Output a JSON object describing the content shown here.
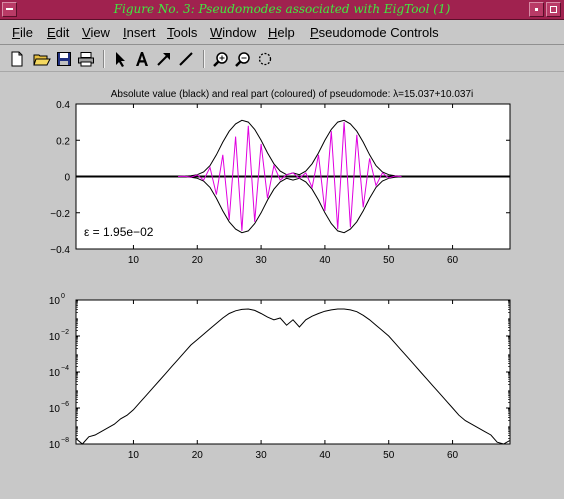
{
  "window": {
    "title": "Figure No. 3: Pseudomodes associated with EigTool (1)"
  },
  "menubar": {
    "items": [
      {
        "label": "File",
        "mnemonic": "F",
        "rest": "ile"
      },
      {
        "label": "Edit",
        "mnemonic": "E",
        "rest": "dit"
      },
      {
        "label": "View",
        "mnemonic": "V",
        "rest": "iew"
      },
      {
        "label": "Insert",
        "mnemonic": "I",
        "rest": "nsert"
      },
      {
        "label": "Tools",
        "mnemonic": "T",
        "rest": "ools"
      },
      {
        "label": "Window",
        "mnemonic": "W",
        "rest": "indow"
      },
      {
        "label": "Help",
        "mnemonic": "H",
        "rest": "elp"
      },
      {
        "label": "Pseudomode Controls",
        "mnemonic": "P",
        "rest": "seudomode Controls"
      }
    ]
  },
  "toolbar": {
    "icons": [
      "new-file-icon",
      "open-folder-icon",
      "save-icon",
      "print-icon",
      "arrow-pointer-icon",
      "text-insert-icon",
      "arrow-draw-icon",
      "line-draw-icon",
      "zoom-in-icon",
      "zoom-out-icon",
      "rotate-icon"
    ]
  },
  "colors": {
    "titlebar": "#a0224f",
    "title_text": "#40e840",
    "real_part": "#e000e0",
    "abs_value": "#000000"
  },
  "chart_data": [
    {
      "type": "line",
      "title": "Absolute value (black) and real part (coloured) of pseudomode: λ=15.037+10.037i",
      "annotation": "ε = 1.95e−02",
      "xlim": [
        1,
        69
      ],
      "ylim": [
        -0.4,
        0.4
      ],
      "xticks": [
        10,
        20,
        30,
        40,
        50,
        60
      ],
      "yticks": [
        -0.4,
        -0.2,
        0,
        0.2,
        0.4
      ],
      "ytick_labels": [
        "−0.4",
        "−0.2",
        "0",
        "0.2",
        "0.4"
      ],
      "grid": false,
      "series": [
        {
          "color": "#000000",
          "mirror": true,
          "x": [
            1,
            2,
            3,
            4,
            5,
            6,
            7,
            8,
            9,
            10,
            11,
            12,
            13,
            14,
            15,
            16,
            17,
            18,
            19,
            20,
            21,
            22,
            23,
            24,
            25,
            26,
            27,
            28,
            29,
            30,
            31,
            32,
            33,
            34,
            35,
            36,
            37,
            38,
            39,
            40,
            41,
            42,
            43,
            44,
            45,
            46,
            47,
            48,
            49,
            50,
            51,
            52,
            53,
            54,
            55,
            56,
            57,
            58,
            59,
            60,
            61,
            62,
            63,
            64,
            65,
            66,
            67,
            68,
            69
          ],
          "y": [
            0,
            0,
            0,
            0,
            0,
            0,
            0,
            0,
            0,
            0,
            0,
            0,
            0,
            0,
            0,
            0,
            0,
            0.001,
            0.004,
            0.01,
            0.025,
            0.06,
            0.12,
            0.19,
            0.25,
            0.29,
            0.31,
            0.3,
            0.26,
            0.2,
            0.13,
            0.07,
            0.03,
            0.01,
            0.02,
            0.01,
            0.03,
            0.07,
            0.13,
            0.2,
            0.26,
            0.3,
            0.31,
            0.29,
            0.25,
            0.19,
            0.12,
            0.06,
            0.025,
            0.01,
            0.004,
            0.001,
            0,
            0,
            0,
            0,
            0,
            0,
            0,
            0,
            0,
            0,
            0,
            0,
            0,
            0,
            0,
            0,
            0
          ]
        },
        {
          "color": "#e000e0",
          "x": [
            17,
            18,
            19,
            20,
            21,
            22,
            23,
            24,
            25,
            26,
            27,
            28,
            29,
            30,
            31,
            32,
            33,
            34,
            35,
            36,
            37,
            38,
            39,
            40,
            41,
            42,
            43,
            44,
            45,
            46,
            47,
            48,
            49,
            50,
            51,
            52
          ],
          "y": [
            0,
            0.001,
            -0.004,
            0.009,
            -0.02,
            0.05,
            -0.1,
            0.12,
            -0.24,
            0.22,
            -0.3,
            0.28,
            -0.25,
            0.18,
            -0.12,
            0.06,
            -0.02,
            0.01,
            0.02,
            -0.01,
            0.02,
            -0.06,
            0.12,
            -0.19,
            0.25,
            -0.29,
            0.3,
            -0.28,
            0.23,
            -0.17,
            0.1,
            -0.05,
            0.02,
            -0.008,
            0.003,
            0
          ]
        }
      ]
    },
    {
      "type": "line",
      "scale_y": "log",
      "xlim": [
        1,
        69
      ],
      "ylim": [
        1e-08,
        1
      ],
      "xticks": [
        10,
        20,
        30,
        40,
        50,
        60
      ],
      "ytick_labels": [
        {
          "base": "10",
          "exp": "0"
        },
        {
          "base": "10",
          "exp": "−2"
        },
        {
          "base": "10",
          "exp": "−4"
        },
        {
          "base": "10",
          "exp": "−6"
        },
        {
          "base": "10",
          "exp": "−8"
        }
      ],
      "ytick_exponents": [
        0,
        -2,
        -4,
        -6,
        -8
      ],
      "grid": false,
      "series": [
        {
          "color": "#000000",
          "x": [
            1,
            2,
            3,
            4,
            5,
            6,
            7,
            8,
            9,
            10,
            11,
            12,
            13,
            14,
            15,
            16,
            17,
            18,
            19,
            20,
            21,
            22,
            23,
            24,
            25,
            26,
            27,
            28,
            29,
            30,
            31,
            32,
            33,
            34,
            35,
            36,
            37,
            38,
            39,
            40,
            41,
            42,
            43,
            44,
            45,
            46,
            47,
            48,
            49,
            50,
            51,
            52,
            53,
            54,
            55,
            56,
            57,
            58,
            59,
            60,
            61,
            62,
            63,
            64,
            65,
            66,
            67,
            68,
            69
          ],
          "log10_y": [
            -7.7,
            -8,
            -7.6,
            -7.5,
            -7.3,
            -7.1,
            -6.9,
            -6.6,
            -6.4,
            -6.1,
            -5.7,
            -5.3,
            -4.9,
            -4.5,
            -4.1,
            -3.7,
            -3.3,
            -2.9,
            -2.5,
            -2.2,
            -1.9,
            -1.6,
            -1.3,
            -1.0,
            -0.75,
            -0.6,
            -0.52,
            -0.5,
            -0.58,
            -0.75,
            -0.95,
            -1.1,
            -1.0,
            -1.4,
            -1.1,
            -1.5,
            -1.1,
            -0.9,
            -0.75,
            -0.62,
            -0.55,
            -0.5,
            -0.5,
            -0.55,
            -0.65,
            -0.85,
            -1.1,
            -1.4,
            -1.7,
            -2.0,
            -2.4,
            -2.8,
            -3.2,
            -3.6,
            -4.0,
            -4.4,
            -4.8,
            -5.2,
            -5.6,
            -6.0,
            -6.4,
            -6.7,
            -6.9,
            -7.1,
            -7.3,
            -7.5,
            -7.9,
            -8,
            -7.8
          ]
        }
      ]
    }
  ]
}
